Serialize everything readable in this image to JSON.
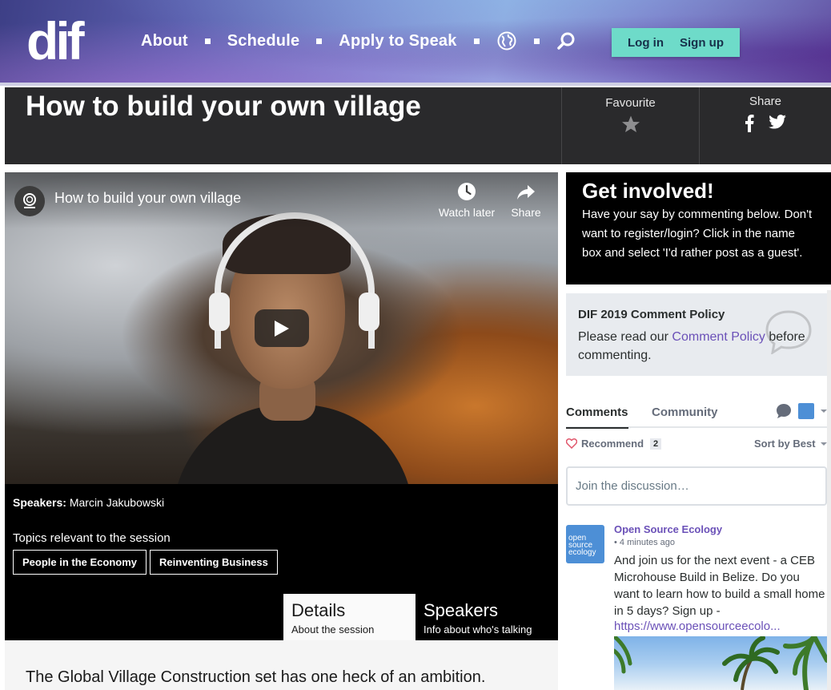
{
  "header": {
    "logo_text": "dif",
    "nav": [
      {
        "label": "About"
      },
      {
        "label": "Schedule"
      },
      {
        "label": "Apply to Speak"
      }
    ],
    "language_icon": "globe-icon",
    "search_icon": "search-icon",
    "login_label": "Log in",
    "signup_label": "Sign up",
    "accent_color": "#6edbc9"
  },
  "session": {
    "title": "How to build your own village",
    "favourite_label": "Favourite",
    "share_label": "Share",
    "speakers_label": "Speakers:",
    "speaker_name": "Marcin Jakubowski",
    "topics_label": "Topics relevant to the session",
    "topics": [
      "People in the Economy",
      "Reinventing Business"
    ],
    "tabs": [
      {
        "title": "Details",
        "subtitle": "About the session"
      },
      {
        "title": "Speakers",
        "subtitle": "Info about who's talking"
      }
    ],
    "description": "The Global Village Construction set has one heck of an ambition."
  },
  "video": {
    "title": "How to build your own village",
    "watch_later_label": "Watch later",
    "share_label": "Share"
  },
  "sidebar": {
    "involved_title": "Get involved!",
    "involved_text": "Have your say by commenting below. Don't want to register/login? Click in the name box and select 'I'd rather post as a guest'.",
    "policy_title": "DIF 2019 Comment Policy",
    "policy_pre": "Please read our ",
    "policy_link": "Comment Policy",
    "policy_post": " before commenting."
  },
  "comments": {
    "tab_comments": "Comments",
    "tab_community": "Community",
    "recommend_label": "Recommend",
    "recommend_count": "2",
    "sort_label": "Sort by Best",
    "join_placeholder": "Join the discussion…",
    "items": [
      {
        "avatar_text": "open source ecology",
        "author": "Open Source Ecology",
        "time": "4 minutes ago",
        "text": "And join us for the next event - a CEB Microhouse Build in Belize. Do you want to learn how to build a small home in 5 days? Sign up -",
        "link": "https://www.opensourceecolo..."
      }
    ],
    "link_color": "#6b51b8"
  }
}
